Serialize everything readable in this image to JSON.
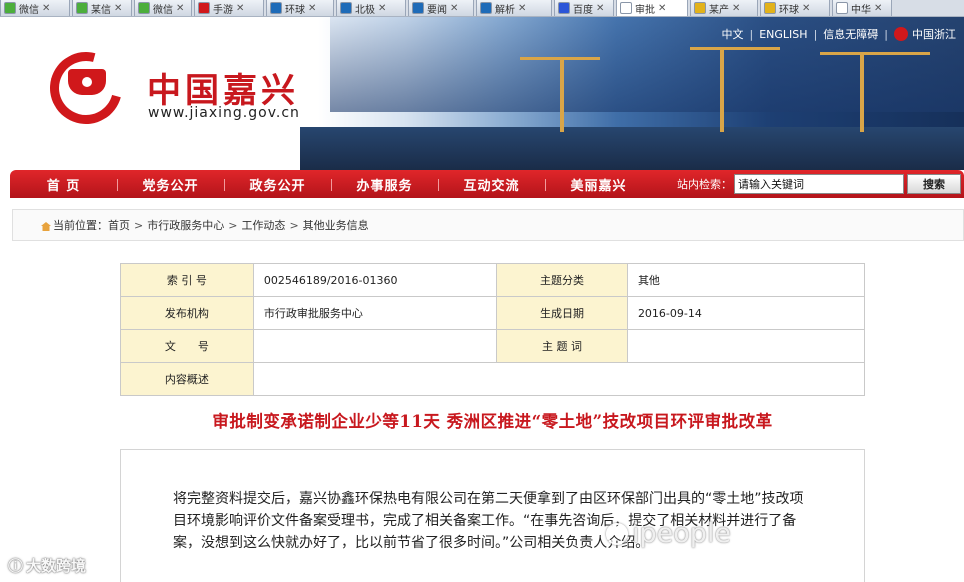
{
  "browser": {
    "tabs": [
      {
        "label": "微信",
        "icon_color": "#4cae3c",
        "active": false
      },
      {
        "label": "某信",
        "icon_color": "#4cae3c",
        "active": false
      },
      {
        "label": "微信",
        "icon_color": "#4cae3c",
        "active": false
      },
      {
        "label": "手游",
        "icon_color": "#d0181b",
        "active": false
      },
      {
        "label": "环球",
        "icon_color": "#1e6bb8",
        "active": false
      },
      {
        "label": "北极",
        "icon_color": "#1e6bb8",
        "active": false
      },
      {
        "label": "要闻",
        "icon_color": "#1e6bb8",
        "active": false
      },
      {
        "label": "解析",
        "icon_color": "#1e6bb8",
        "active": false
      },
      {
        "label": "百度",
        "icon_color": "#2b55d8",
        "active": false
      },
      {
        "label": "审批",
        "icon_color": "#ffffff",
        "active": true
      },
      {
        "label": "某产",
        "icon_color": "#e2b21a",
        "active": false
      },
      {
        "label": "环球",
        "icon_color": "#e2b21a",
        "active": false
      },
      {
        "label": "中华",
        "icon_color": "#ffffff",
        "active": false
      }
    ],
    "close_glyph": "✕"
  },
  "header": {
    "site_title": "中国嘉兴",
    "site_url": "www.jiaxing.gov.cn",
    "links": [
      "中文",
      "ENGLISH",
      "信息无障碍",
      "中国浙江"
    ],
    "brand_color": "#c8181e"
  },
  "nav": {
    "items": [
      "首 页",
      "党务公开",
      "政务公开",
      "办事服务",
      "互动交流",
      "美丽嘉兴"
    ],
    "search_label": "站内检索：",
    "search_value": "请输入关键词",
    "search_button": "搜索"
  },
  "breadcrumb": {
    "prefix": "当前位置：",
    "items": [
      "首页",
      "市行政服务中心",
      "工作动态",
      "其他业务信息"
    ],
    "separator": ">"
  },
  "meta": {
    "rows": [
      [
        {
          "k": "索 引 号",
          "v": "002546189/2016-01360"
        },
        {
          "k": "主题分类",
          "v": "其他"
        }
      ],
      [
        {
          "k": "发布机构",
          "v": "市行政审批服务中心"
        },
        {
          "k": "生成日期",
          "v": "2016-09-14"
        }
      ],
      [
        {
          "k": "文　　号",
          "v": ""
        },
        {
          "k": "主 题 词",
          "v": ""
        }
      ]
    ],
    "summary_key": "内容概述",
    "summary_value": ""
  },
  "article": {
    "title": "审批制变承诺制企业少等11天 秀洲区推进“零土地”技改项目环评审批改革",
    "body": "将完整资料提交后，嘉兴协鑫环保热电有限公司在第二天便拿到了由区环保部门出具的“零土地”技改项目环境影响评价文件备案受理书，完成了相关备案工作。“在事先咨询后，提交了相关材料并进行了备案，没想到这么快就办好了，比以前节省了很多时间。”公司相关负责人介绍。"
  },
  "watermarks": {
    "left": "大数跨境",
    "right": "ipeople"
  }
}
